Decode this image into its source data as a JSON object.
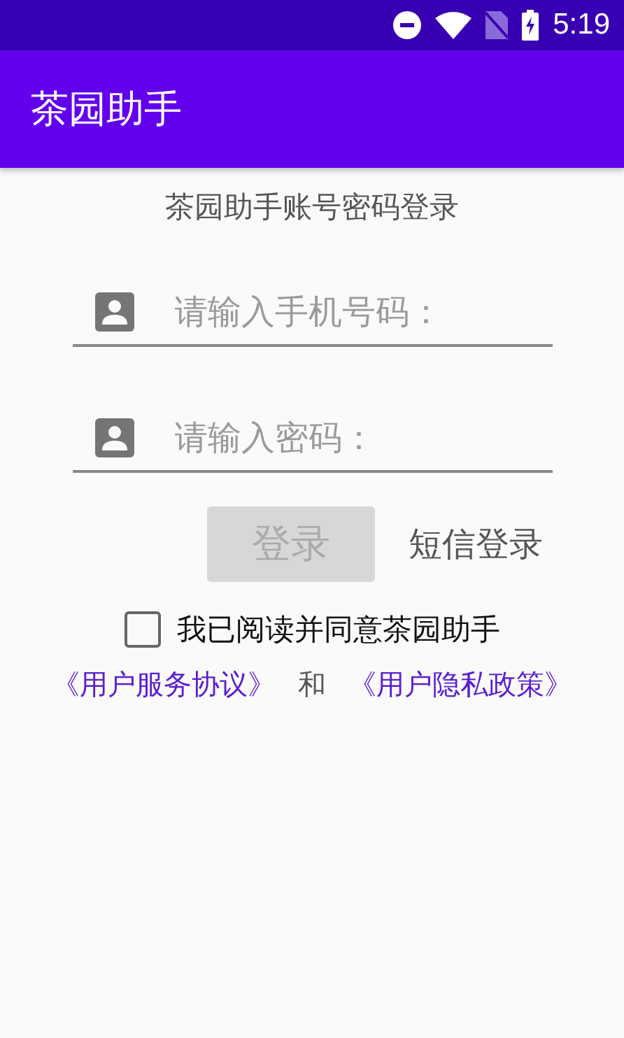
{
  "status_bar": {
    "time": "5:19"
  },
  "app_bar": {
    "title": "茶园助手"
  },
  "heading": "茶园助手账号密码登录",
  "fields": [
    {
      "placeholder": "请输入手机号码："
    },
    {
      "placeholder": "请输入密码："
    }
  ],
  "login_button": {
    "label": "登录",
    "disabled": true
  },
  "sms_login": "短信登录",
  "agreement": {
    "checked": false,
    "label": "我已阅读并同意茶园助手"
  },
  "policy_line": [
    {
      "kind": "link",
      "text": "《用户服务协议》"
    },
    {
      "kind": "plain",
      "text": "和"
    },
    {
      "kind": "link",
      "text": "《用户隐私政策》"
    }
  ]
}
